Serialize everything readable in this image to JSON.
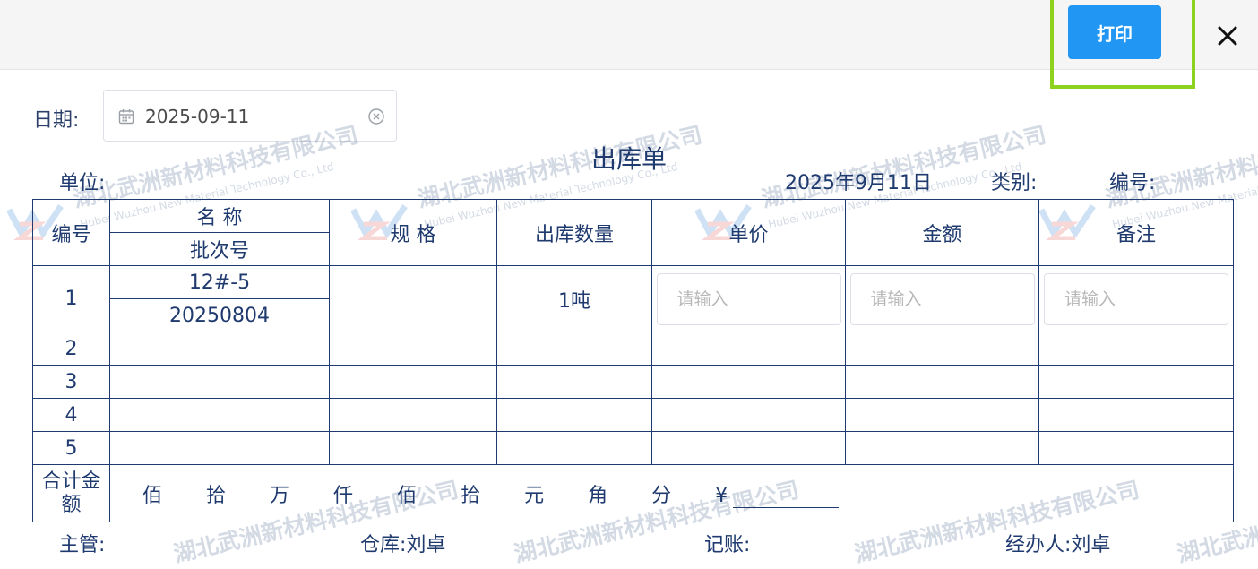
{
  "toolbar": {
    "print_label": "打印",
    "close_icon": "close-icon"
  },
  "date_filter": {
    "label": "日期:",
    "value": "2025-09-11"
  },
  "form": {
    "title": "出库单",
    "unit_label": "单位:",
    "date_text": "2025年9月11日",
    "category_label": "类别:",
    "number_label": "编号:"
  },
  "table": {
    "headers": {
      "number": "编号",
      "name": "名 称",
      "batch": "批次号",
      "spec": "规 格",
      "qty": "出库数量",
      "price": "单价",
      "amount": "金额",
      "remark": "备注"
    },
    "input_placeholder": "请输入",
    "first_row": {
      "no": "1",
      "name": "12#-5",
      "batch": "20250804",
      "qty": "1吨"
    },
    "row_numbers": [
      "2",
      "3",
      "4",
      "5"
    ],
    "total": {
      "label": "合计金额",
      "units": [
        "佰",
        "拾",
        "万",
        "仟",
        "佰",
        "拾",
        "元",
        "角",
        "分"
      ],
      "yen": "¥"
    }
  },
  "footer": {
    "supervisor": "主管:",
    "warehouse": "仓库:刘卓",
    "bookkeeping": "记账:",
    "handler": "经办人:刘卓"
  },
  "watermark": {
    "company_cn": "湖北武洲新材料科技有限公司",
    "company_en": "Hubei Wuzhou New Material Technology Co., Ltd"
  },
  "colors": {
    "accent": "#2196f3",
    "text": "#1f3a6e",
    "highlight": "#8cd21e"
  }
}
